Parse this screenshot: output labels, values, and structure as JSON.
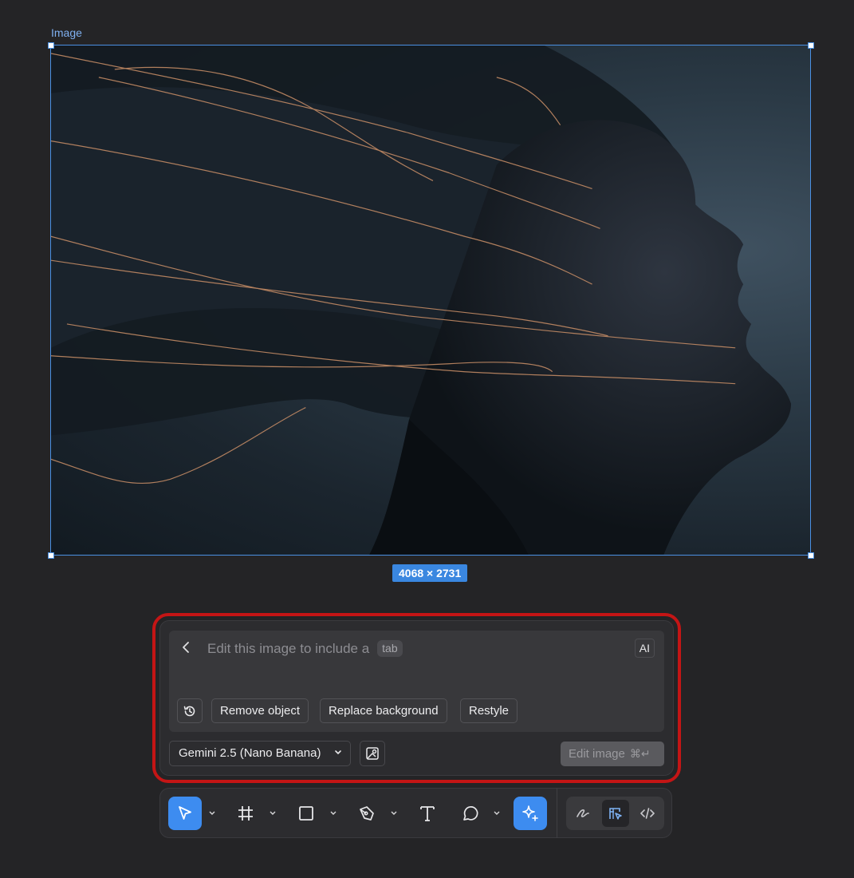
{
  "canvas": {
    "frame_label": "Image",
    "dimensions": "4068 × 2731"
  },
  "prompt_panel": {
    "placeholder": "Edit this image to include a",
    "tab_hint": "tab",
    "ai_badge": "AI",
    "suggestions": [
      "Remove object",
      "Replace background",
      "Restyle"
    ],
    "model": "Gemini 2.5 (Nano Banana)",
    "edit_button": "Edit image",
    "edit_shortcut": "⌘↵"
  },
  "toolbar": {
    "tools": [
      "move-tool",
      "frame-tool",
      "shape-tool",
      "pen-tool",
      "text-tool",
      "comment-tool",
      "ai-tool"
    ],
    "active_tool": "move-tool",
    "modes": [
      "draw-mode",
      "design-mode",
      "dev-mode"
    ],
    "active_mode": "design-mode"
  },
  "colors": {
    "selection": "#4a90e2",
    "accent": "#3d8cf0",
    "highlight": "#c41515",
    "background": "#242426"
  }
}
